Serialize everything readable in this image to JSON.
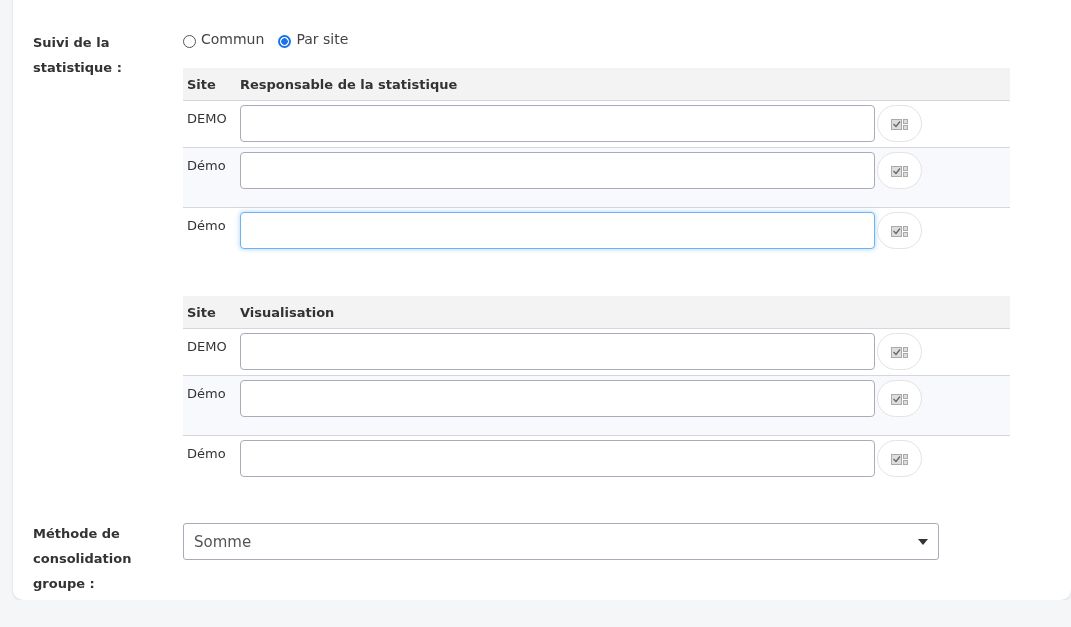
{
  "fields": [
    {
      "kind": "radio",
      "label": "Suivi de la statistique :",
      "options": [
        {
          "label": "Commun",
          "selected": false
        },
        {
          "label": "Par site",
          "selected": true
        }
      ],
      "tables": [
        {
          "columns": [
            "Site",
            "Responsable de la statistique"
          ],
          "rows": [
            {
              "site": "DEMO",
              "value": "",
              "focused": false
            },
            {
              "site": "Démo",
              "value": "",
              "focused": false
            },
            {
              "site": "Démo",
              "value": "",
              "focused": true
            }
          ]
        },
        {
          "columns": [
            "Site",
            "Visualisation"
          ],
          "rows": [
            {
              "site": "DEMO",
              "value": "",
              "focused": false
            },
            {
              "site": "Démo",
              "value": "",
              "focused": false
            },
            {
              "site": "Démo",
              "value": "",
              "focused": false
            }
          ]
        }
      ]
    },
    {
      "kind": "select",
      "label": "Méthode de consolidation groupe :",
      "value": "Somme"
    }
  ]
}
